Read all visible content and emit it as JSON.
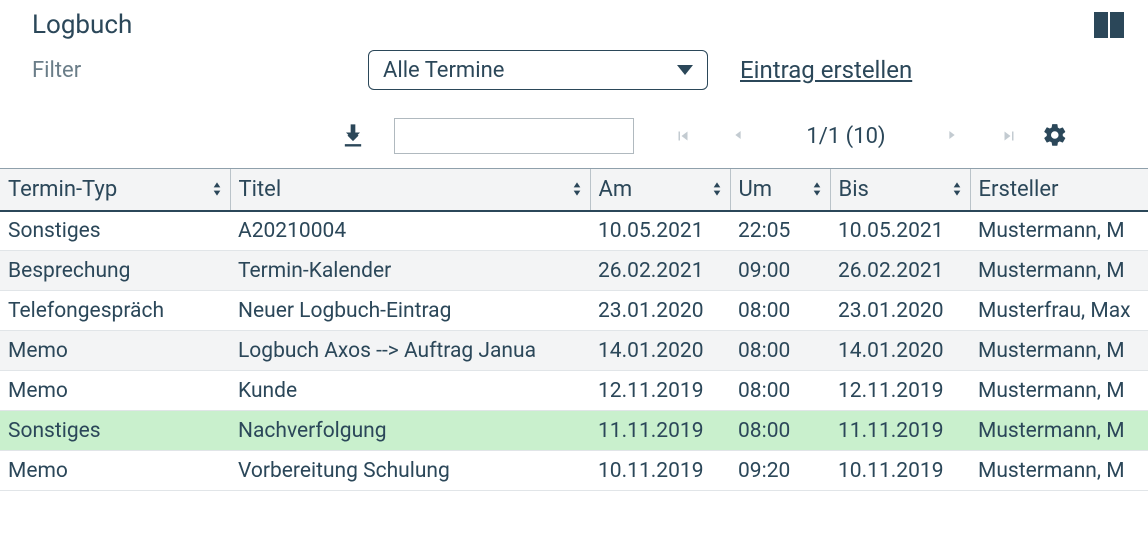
{
  "header": {
    "title": "Logbuch"
  },
  "filter": {
    "label": "Filter",
    "selected": "Alle Termine",
    "create_link": "Eintrag erstellen"
  },
  "toolbar": {
    "search_value": "",
    "pager_text": "1/1 (10)"
  },
  "columns": {
    "type": "Termin-Typ",
    "title": "Titel",
    "am": "Am",
    "um": "Um",
    "bis": "Bis",
    "ersteller": "Ersteller"
  },
  "rows": [
    {
      "type": "Sonstiges",
      "title": "A20210004",
      "am": "10.05.2021",
      "um": "22:05",
      "bis": "10.05.2021",
      "ersteller": "Mustermann, M",
      "hl": false
    },
    {
      "type": "Besprechung",
      "title": "Termin-Kalender",
      "am": "26.02.2021",
      "um": "09:00",
      "bis": "26.02.2021",
      "ersteller": "Mustermann, M",
      "hl": false
    },
    {
      "type": "Telefongespräch",
      "title": "Neuer Logbuch-Eintrag",
      "am": "23.01.2020",
      "um": "08:00",
      "bis": "23.01.2020",
      "ersteller": "Musterfrau, Max",
      "hl": false
    },
    {
      "type": "Memo",
      "title": "Logbuch Axos --> Auftrag Janua",
      "am": "14.01.2020",
      "um": "08:00",
      "bis": "14.01.2020",
      "ersteller": "Mustermann, M",
      "hl": false
    },
    {
      "type": "Memo",
      "title": "Kunde",
      "am": "12.11.2019",
      "um": "08:00",
      "bis": "12.11.2019",
      "ersteller": "Mustermann, M",
      "hl": false
    },
    {
      "type": "Sonstiges",
      "title": "Nachverfolgung",
      "am": "11.11.2019",
      "um": "08:00",
      "bis": "11.11.2019",
      "ersteller": "Mustermann, M",
      "hl": true
    },
    {
      "type": "Memo",
      "title": "Vorbereitung Schulung",
      "am": "10.11.2019",
      "um": "09:20",
      "bis": "10.11.2019",
      "ersteller": "Mustermann, M",
      "hl": false
    }
  ]
}
